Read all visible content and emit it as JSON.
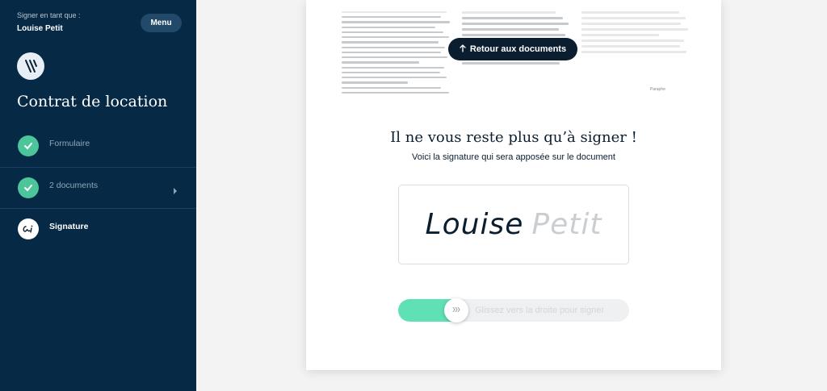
{
  "sidebar": {
    "signer_label": "Signer en tant que :",
    "signer_name": "Louise Petit",
    "menu_label": "Menu",
    "doc_title": "Contrat de location",
    "steps": [
      {
        "label": "Formulaire",
        "status": "done"
      },
      {
        "label": "2 documents",
        "status": "done"
      },
      {
        "label": "Signature",
        "status": "current"
      }
    ]
  },
  "main": {
    "back_label": "Retour aux documents",
    "paraphe": "Paraphe",
    "title": "Il ne vous reste plus qu’à signer !",
    "subtitle": "Voici la signature qui sera apposée sur le document",
    "signature": {
      "first": "Louise",
      "last": "Petit"
    },
    "slider": {
      "label": "Glissez vers la droite pour signer",
      "progress": 0.25
    }
  },
  "colors": {
    "sidebar_bg": "#062a45",
    "accent": "#4cc59b",
    "slider_fill": "#5fe0b5",
    "dark": "#0b1e30"
  }
}
